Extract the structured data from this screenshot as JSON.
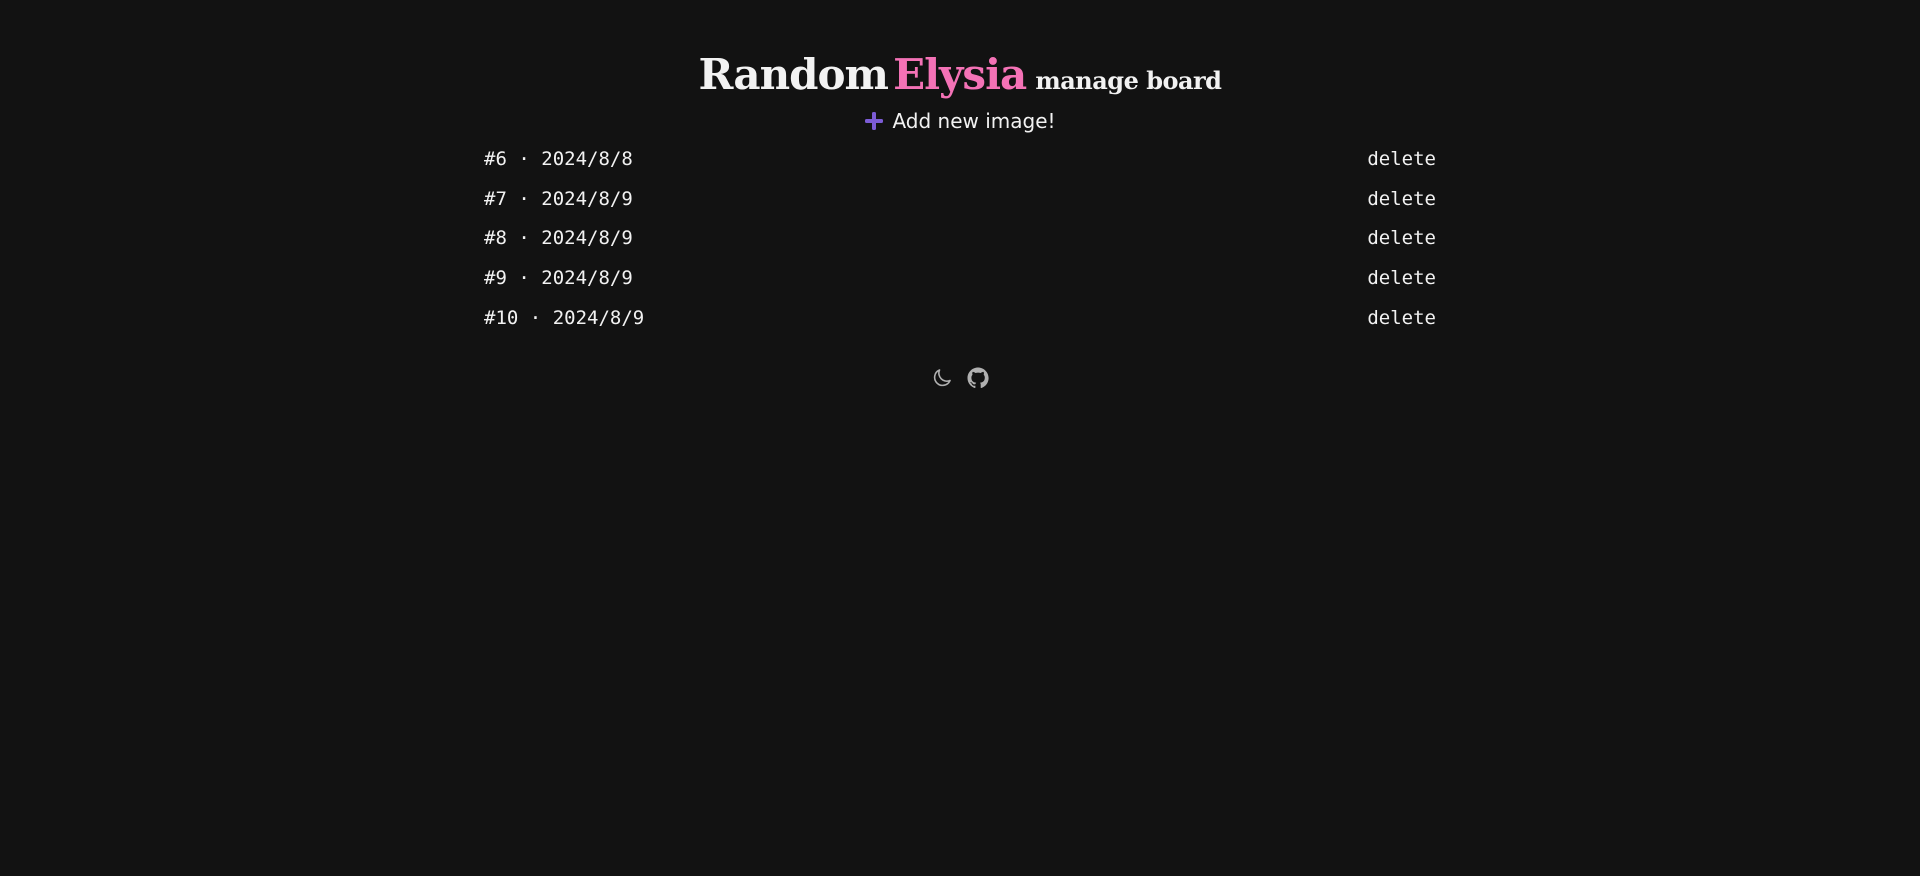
{
  "header": {
    "title_main": "Random",
    "title_accent": "Elysia",
    "title_sub": "manage board"
  },
  "add_button": {
    "label": "Add new image!",
    "icon": "plus-icon"
  },
  "entries": [
    {
      "id": "#6",
      "date": "2024/8/8",
      "delete_label": "delete"
    },
    {
      "id": "#7",
      "date": "2024/8/9",
      "delete_label": "delete"
    },
    {
      "id": "#8",
      "date": "2024/8/9",
      "delete_label": "delete"
    },
    {
      "id": "#9",
      "date": "2024/8/9",
      "delete_label": "delete"
    },
    {
      "id": "#10",
      "date": "2024/8/9",
      "delete_label": "delete"
    }
  ],
  "separator": "·",
  "footer": {
    "icons": [
      "moon-icon",
      "github-icon"
    ]
  },
  "colors": {
    "background": "#121212",
    "text": "#f2f2f2",
    "accent": "#f472b6",
    "plus": "#7c5cd6",
    "icon": "#b0b0b0"
  }
}
